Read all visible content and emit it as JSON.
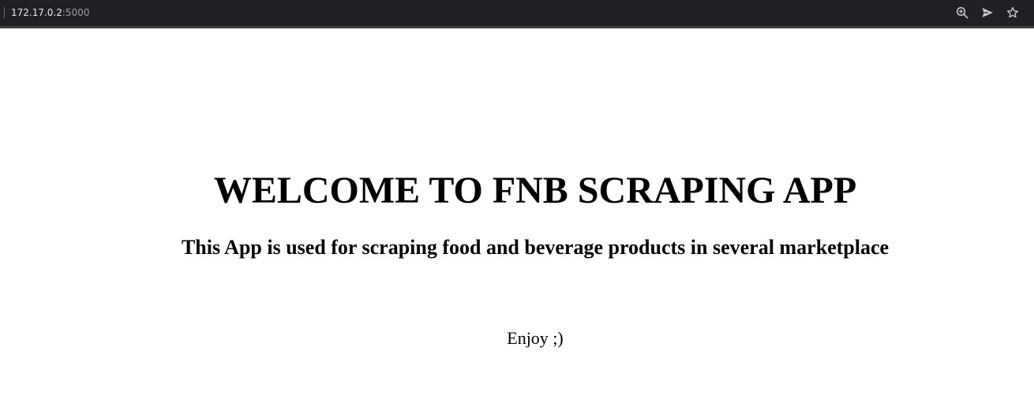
{
  "browser": {
    "url_host": "172.17.0.2",
    "url_port": ":5000",
    "icons": [
      "zoom-icon",
      "send-icon",
      "star-icon"
    ]
  },
  "page": {
    "title": "WELCOME TO FNB SCRAPING APP",
    "subtitle": "This App is used for scraping food and beverage products in several marketplace",
    "footer_text": "Enjoy ;)"
  },
  "colors": {
    "toolbar_bg": "#202124",
    "url_host": "#e8eaed",
    "url_port": "#9aa0a6",
    "page_bg": "#ffffff",
    "text": "#000000"
  }
}
